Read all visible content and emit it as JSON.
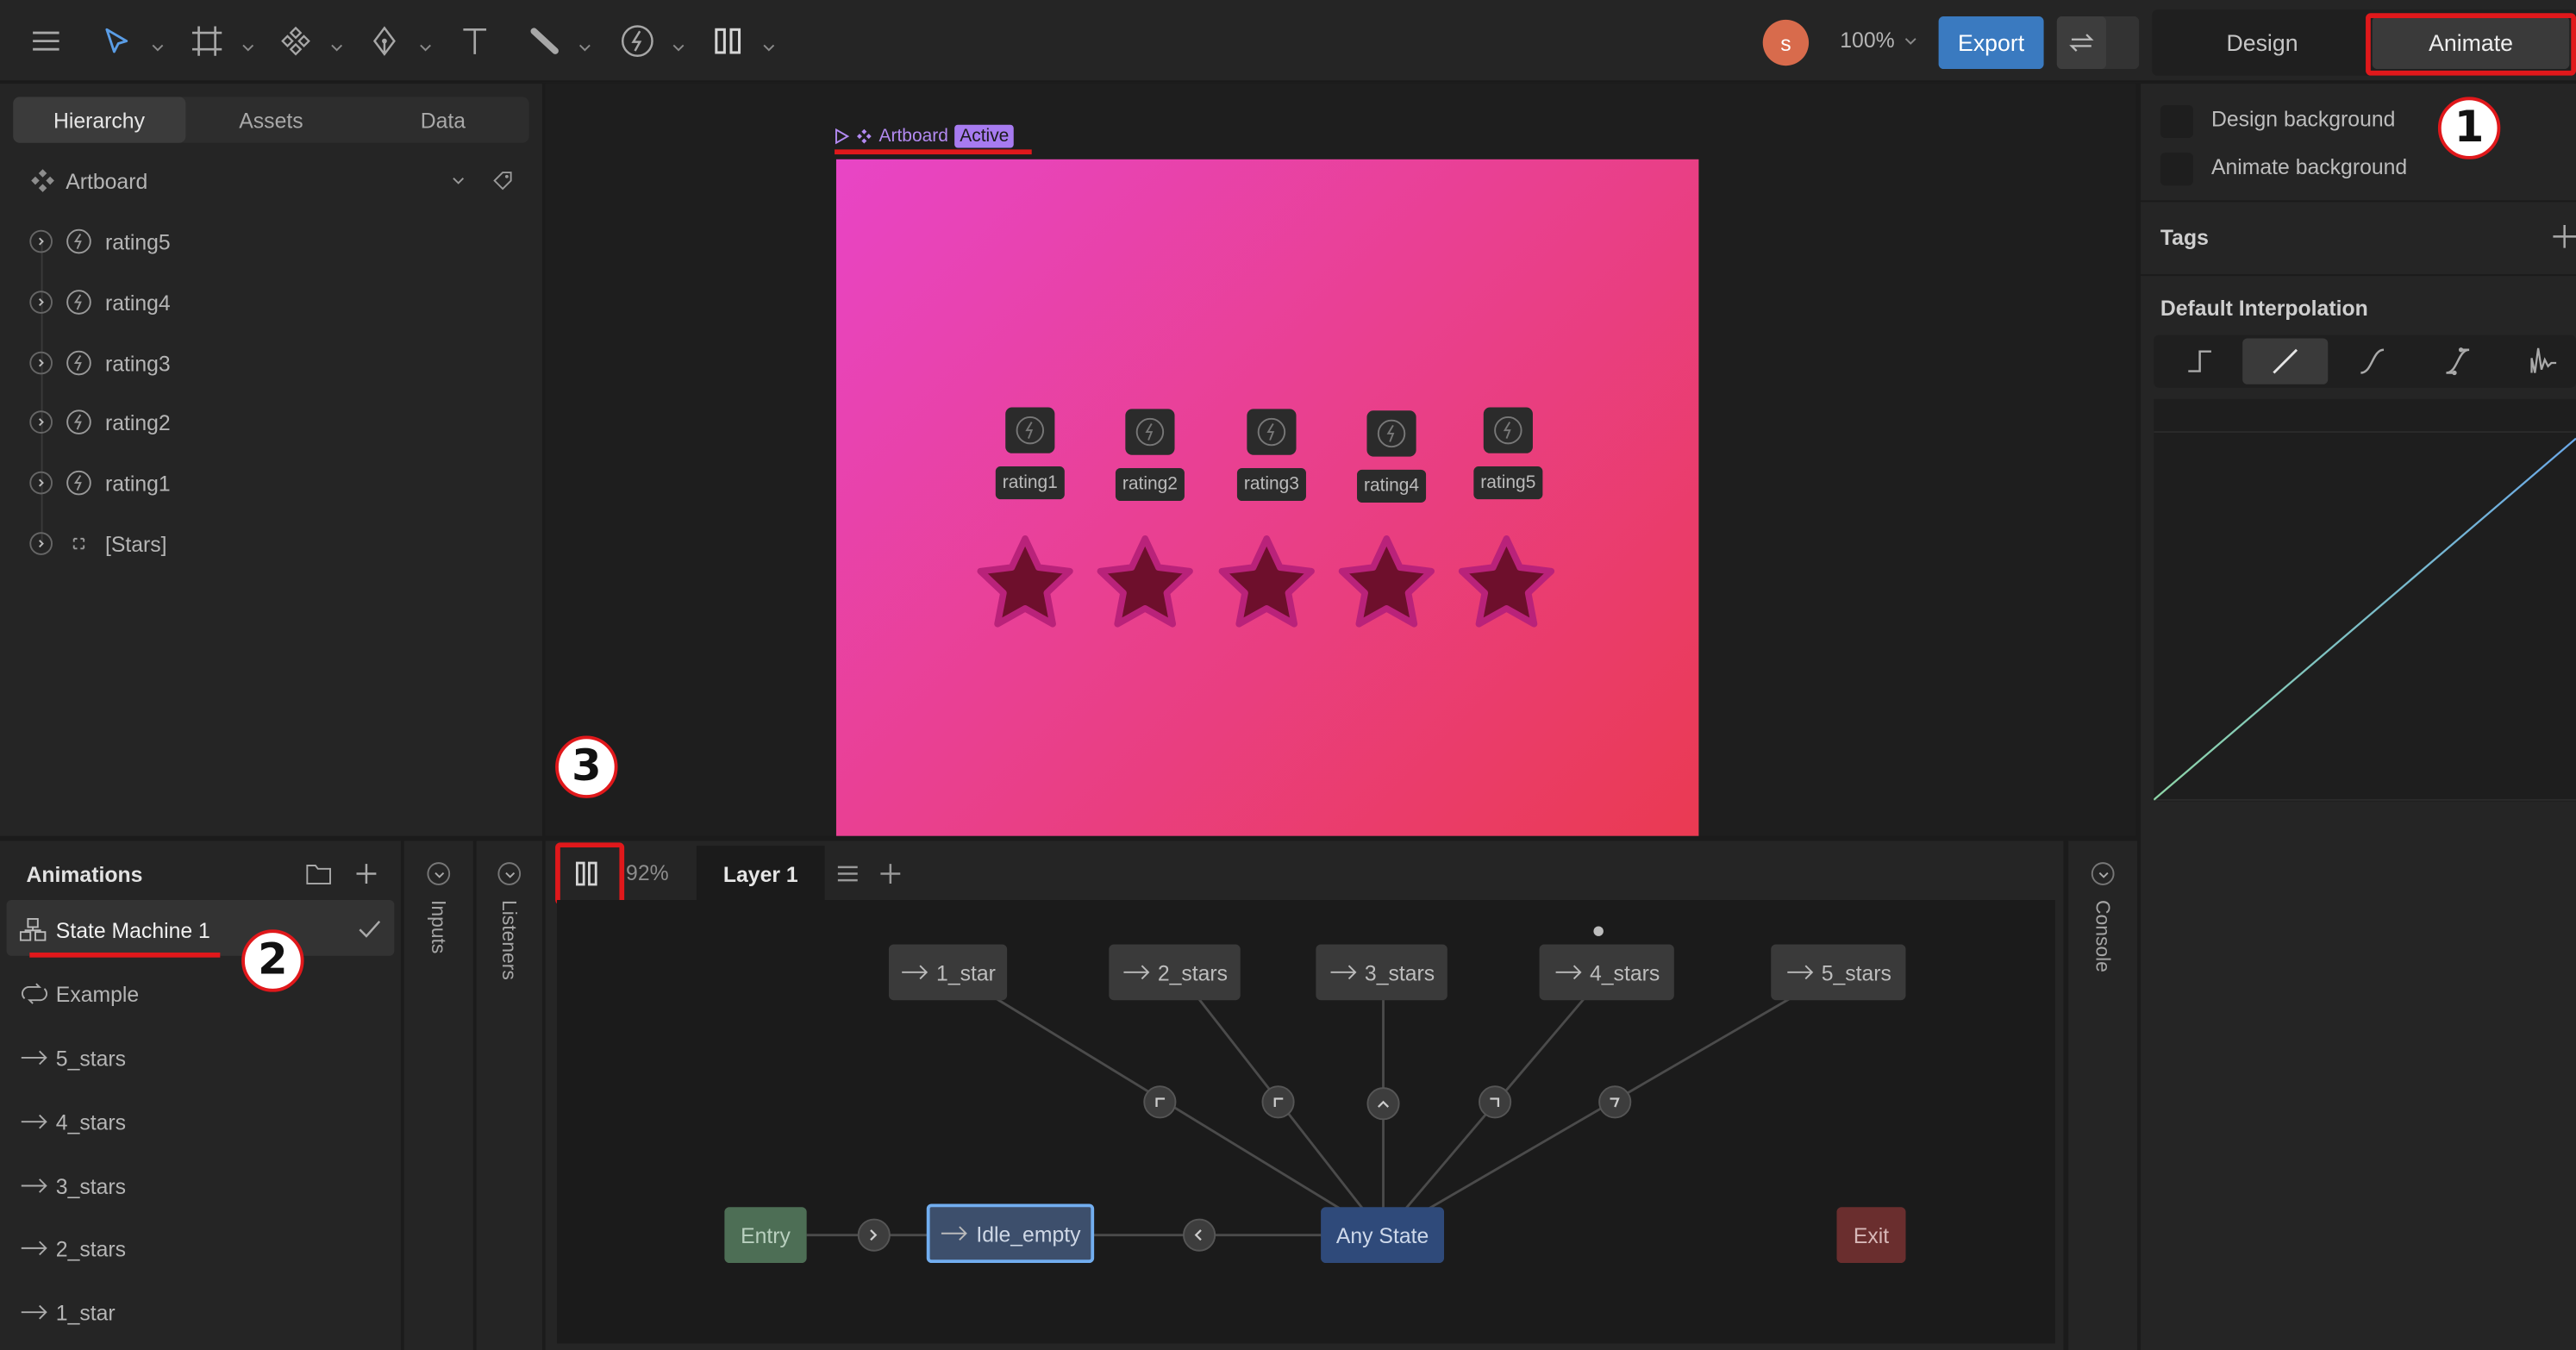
{
  "toolbar": {
    "user_initial": "s",
    "zoom": "100%",
    "export_label": "Export",
    "mode_design": "Design",
    "mode_animate": "Animate"
  },
  "left_tabs": [
    "Hierarchy",
    "Assets",
    "Data"
  ],
  "hierarchy": {
    "artboard": "Artboard",
    "items": [
      "rating5",
      "rating4",
      "rating3",
      "rating2",
      "rating1",
      "[Stars]"
    ]
  },
  "animations": {
    "title": "Animations",
    "items": [
      "State Machine 1",
      "Example",
      "5_stars",
      "4_stars",
      "3_stars",
      "2_stars",
      "1_star"
    ]
  },
  "side_tabs": {
    "inputs": "Inputs",
    "listeners": "Listeners",
    "console": "Console"
  },
  "canvas": {
    "artboard_label": "Artboard",
    "active_badge": "Active",
    "rating_labels": [
      "rating1",
      "rating2",
      "rating3",
      "rating4",
      "rating5"
    ],
    "gradient_from": "#e845c6",
    "gradient_to": "#ea3a52",
    "star_fill": "#6e0f2c",
    "star_stroke": "#b9227a"
  },
  "graph": {
    "zoom": "92%",
    "layer_tab": "Layer 1",
    "nodes": {
      "one_star": "1_star",
      "two_stars": "2_stars",
      "three_stars": "3_stars",
      "four_stars": "4_stars",
      "five_stars": "5_stars",
      "entry": "Entry",
      "idle": "Idle_empty",
      "any_state": "Any State",
      "exit": "Exit"
    }
  },
  "right_panel": {
    "design_background": "Design background",
    "animate_background": "Animate background",
    "tags": "Tags",
    "default_interpolation": "Default Interpolation"
  },
  "annotations": {
    "one": "1",
    "two": "2",
    "three": "3"
  },
  "accent": "#3a7ac0"
}
